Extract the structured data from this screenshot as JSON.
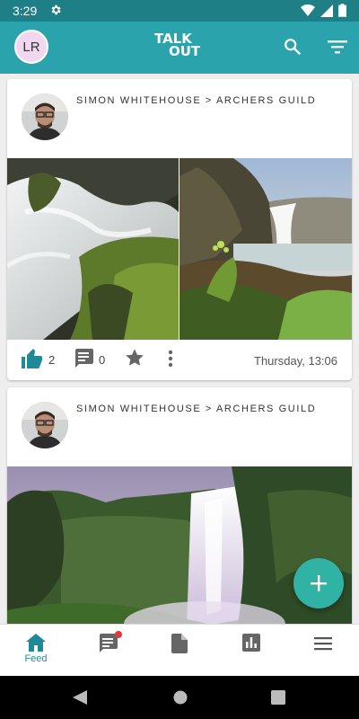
{
  "status_bar": {
    "time": "3:29"
  },
  "app_bar": {
    "avatar_initials": "LR",
    "logo_line1": "TALK",
    "logo_line2": "OUT"
  },
  "posts": [
    {
      "author_path": "SIMON WHITEHOUSE > ARCHERS GUILD",
      "likes": "2",
      "comments": "0",
      "date": "Thursday, 13:06"
    },
    {
      "author_path": "SIMON WHITEHOUSE > ARCHERS GUILD"
    }
  ],
  "bottom_nav": {
    "feed_label": "Feed"
  },
  "colors": {
    "accent": "#2aa3ac",
    "status_bar": "#1e7f86",
    "fab": "#30b3a5",
    "like": "#1e8a99",
    "badge": "#e53935"
  }
}
